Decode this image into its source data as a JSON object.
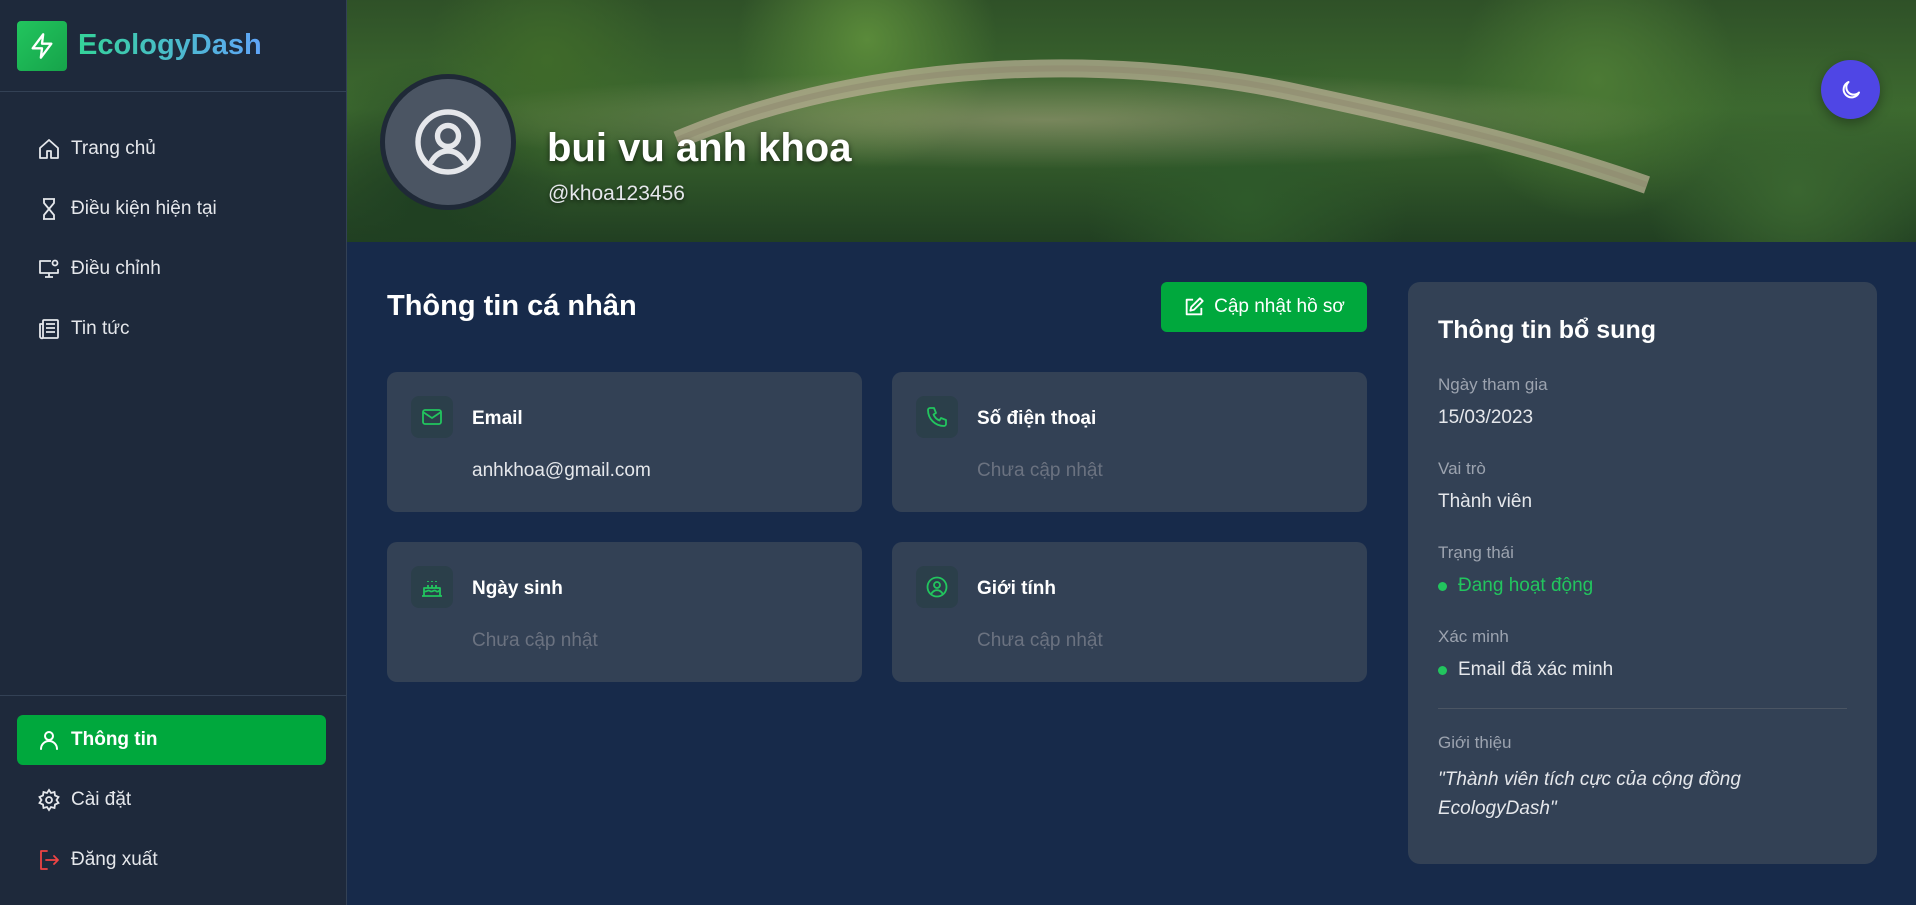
{
  "brand": {
    "name": "EcologyDash"
  },
  "sidebar": {
    "items": [
      {
        "label": "Trang chủ",
        "icon": "home-icon"
      },
      {
        "label": "Điều kiện hiện tại",
        "icon": "hourglass-icon"
      },
      {
        "label": "Điều chỉnh",
        "icon": "monitor-settings-icon"
      },
      {
        "label": "Tin tức",
        "icon": "newspaper-icon"
      }
    ],
    "bottom": [
      {
        "label": "Thông tin",
        "icon": "user-icon",
        "active": true
      },
      {
        "label": "Cài đặt",
        "icon": "gear-icon"
      },
      {
        "label": "Đăng xuất",
        "icon": "logout-icon"
      }
    ]
  },
  "profile": {
    "name": "bui vu anh khoa",
    "handle": "@khoa123456"
  },
  "personal": {
    "title": "Thông tin cá nhân",
    "update_label": "Cập nhật hồ sơ",
    "cards": [
      {
        "label": "Email",
        "value": "anhkhoa@gmail.com",
        "icon": "mail-icon"
      },
      {
        "label": "Số điện thoại",
        "value": "Chưa cập nhật",
        "icon": "phone-icon"
      },
      {
        "label": "Ngày sinh",
        "value": "Chưa cập nhật",
        "icon": "cake-icon"
      },
      {
        "label": "Giới tính",
        "value": "Chưa cập nhật",
        "icon": "user-circle-icon"
      }
    ]
  },
  "extra": {
    "title": "Thông tin bổ sung",
    "join_label": "Ngày tham gia",
    "join_value": "15/03/2023",
    "role_label": "Vai trò",
    "role_value": "Thành viên",
    "status_label": "Trạng thái",
    "status_value": "Đang hoạt động",
    "verify_label": "Xác minh",
    "verify_value": "Email đã xác minh",
    "intro_label": "Giới thiệu",
    "intro_value": "\"Thành viên tích cực của cộng đồng EcologyDash\""
  },
  "colors": {
    "accent": "#00a83d",
    "sidebar": "#1e293b",
    "main": "#172a4a",
    "card": "#334155",
    "theme_button": "#4f46e5"
  }
}
